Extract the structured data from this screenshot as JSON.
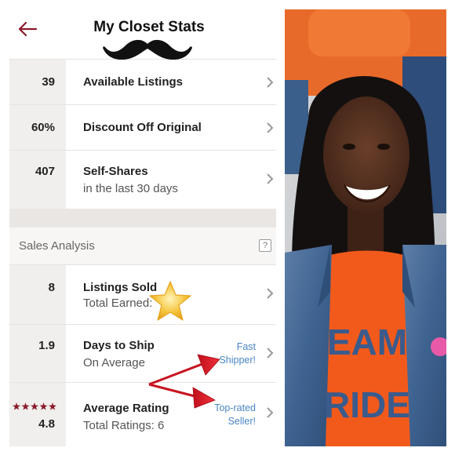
{
  "header": {
    "title": "My Closet Stats",
    "back_icon": "left-arrow-icon",
    "decoration_icon": "mustache-icon"
  },
  "stats": [
    {
      "value": "39",
      "label": "Available Listings"
    },
    {
      "value": "60%",
      "label": "Discount Off Original"
    },
    {
      "value": "407",
      "label": "Self-Shares",
      "sublabel": "in the last 30 days"
    }
  ],
  "sales_analysis": {
    "title": "Sales Analysis",
    "help_label": "?",
    "rows": [
      {
        "value": "8",
        "label": "Listings Sold",
        "sublabel": "Total Earned:"
      },
      {
        "value": "1.9",
        "label": "Days to Ship",
        "sublabel": "On Average",
        "note_line1": "Fast",
        "note_line2": "Shipper!"
      },
      {
        "value": "4.8",
        "label": "Average Rating",
        "sublabel": "Total Ratings: 6",
        "note_line1": "Top-rated",
        "note_line2": "Seller!",
        "stars": 5
      }
    ]
  },
  "photo": {
    "shirt_text_line1": "EAM",
    "shirt_text_line2": "RIDE"
  },
  "colors": {
    "accent": "#8b1a2b",
    "link_blue": "#4a86c6",
    "arrow_red": "#e0202a",
    "star_gold": "#f5c33b",
    "shirt_orange": "#f25a1c"
  }
}
